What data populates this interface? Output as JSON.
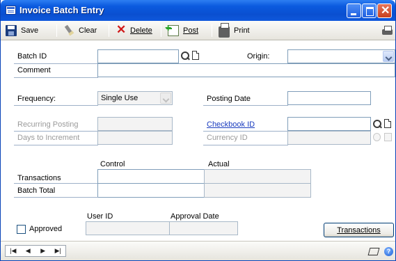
{
  "window": {
    "title": "Invoice Batch Entry"
  },
  "toolbar": {
    "save": "Save",
    "clear": "Clear",
    "delete": "Delete",
    "post": "Post",
    "print": "Print"
  },
  "form": {
    "batch_id_label": "Batch ID",
    "batch_id_value": "",
    "origin_label": "Origin:",
    "origin_value": "",
    "comment_label": "Comment",
    "comment_value": "",
    "frequency_label": "Frequency:",
    "frequency_value": "Single Use",
    "posting_date_label": "Posting Date",
    "posting_date_value": "",
    "recurring_posting_label": "Recurring Posting",
    "days_to_increment_label": "Days to Increment",
    "checkbook_id_label": "Checkbook ID",
    "checkbook_id_value": "",
    "currency_id_label": "Currency ID",
    "grid": {
      "col_control": "Control",
      "col_actual": "Actual",
      "row_transactions": "Transactions",
      "row_batch_total": "Batch Total"
    },
    "approval": {
      "user_id_label": "User ID",
      "approval_date_label": "Approval Date",
      "approved_label": "Approved",
      "approved_checked": false
    },
    "transactions_button": "Transactions"
  },
  "statusbar": {
    "nav": [
      "|◀",
      "◀",
      "▶",
      "▶|"
    ]
  },
  "colors": {
    "titlebar": "#0b5adf",
    "link": "#1a3cbf",
    "field_border": "#7f9db9"
  }
}
